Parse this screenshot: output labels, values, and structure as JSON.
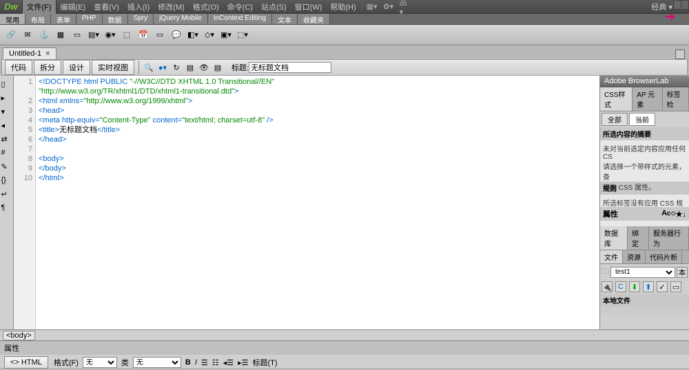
{
  "app": {
    "logo": "Dw",
    "workspace": "经典 ▾"
  },
  "menu": [
    {
      "label": "文件(F)"
    },
    {
      "label": "编辑(E)"
    },
    {
      "label": "查看(V)"
    },
    {
      "label": "插入(I)"
    },
    {
      "label": "修改(M)"
    },
    {
      "label": "格式(O)"
    },
    {
      "label": "命令(C)"
    },
    {
      "label": "站点(S)"
    },
    {
      "label": "窗口(W)"
    },
    {
      "label": "帮助(H)"
    }
  ],
  "insertTabs": [
    {
      "label": "常用"
    },
    {
      "label": "布局"
    },
    {
      "label": "表单"
    },
    {
      "label": "PHP"
    },
    {
      "label": "数据"
    },
    {
      "label": "Spry"
    },
    {
      "label": "jQuery Mobile"
    },
    {
      "label": "InContext Editing"
    },
    {
      "label": "文本"
    },
    {
      "label": "收藏夹"
    }
  ],
  "docTab": {
    "name": "Untitled-1",
    "close": "×"
  },
  "viewButtons": [
    {
      "label": "代码"
    },
    {
      "label": "拆分"
    },
    {
      "label": "设计"
    },
    {
      "label": "实时视图"
    }
  ],
  "titleLabel": "标题:",
  "titleValue": "无标题文档",
  "code": {
    "lines": [
      "1",
      "2",
      "3",
      "4",
      "5",
      "6",
      "7",
      "8",
      "9",
      "10"
    ],
    "l1a": "<!DOCTYPE html PUBLIC ",
    "l1b": "\"-//W3C//DTD XHTML 1.0 Transitional//EN\"",
    "l1c": "\"http://www.w3.org/TR/xhtml1/DTD/xhtml1-transitional.dtd\"",
    "l1d": ">",
    "l2a": "<html xmlns=",
    "l2b": "\"http://www.w3.org/1999/xhtml\"",
    "l2c": ">",
    "l3": "<head>",
    "l4a": "<meta http-equiv=",
    "l4b": "\"Content-Type\"",
    "l4c": " content=",
    "l4d": "\"text/html; charset=utf-8\"",
    "l4e": " />",
    "l5a": "<title>",
    "l5b": "无标题文档",
    "l5c": "</title>",
    "l6": "</head>",
    "l7": "",
    "l8": "<body>",
    "l9": "</body>",
    "l10": "</html>"
  },
  "tagPath": "<body>",
  "panels": {
    "browserlab": "Adobe BrowserLab",
    "cssTabs": [
      {
        "label": "CSS样式"
      },
      {
        "label": "AP 元素"
      },
      {
        "label": "标签检"
      }
    ],
    "cssScope": [
      {
        "label": "全部"
      },
      {
        "label": "当前"
      }
    ],
    "summaryHdr": "所选内容的摘要",
    "summaryBody": "未对当前选定内容应用任何 CS\n请选择一个带样式的元素，查\n哪些 CSS 属性。",
    "rulesHdr": "规则",
    "rulesBody": "所选标签没有应用 CSS 规则。",
    "propsHdr": "属性",
    "dbTabs": [
      {
        "label": "数据库"
      },
      {
        "label": "绑定"
      },
      {
        "label": "服务器行为"
      }
    ],
    "fileTabs": [
      {
        "label": "文件"
      },
      {
        "label": "资源"
      },
      {
        "label": "代码片断"
      }
    ],
    "site": "test1",
    "siteBtn": "本",
    "localHdr": "本地文件"
  },
  "properties": {
    "hdr": "属性",
    "htmlBtn": "<> HTML",
    "formatLbl": "格式(F)",
    "formatVal": "无",
    "classLbl": "类",
    "classVal": "无",
    "titleLbl": "标题(T)"
  }
}
